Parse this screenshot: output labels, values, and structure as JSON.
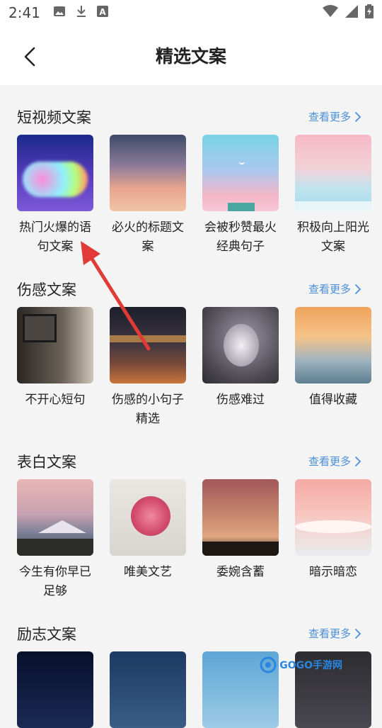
{
  "status": {
    "time": "2:41",
    "icons": [
      "image-icon",
      "download-icon",
      "text-a-icon"
    ],
    "right_icons": [
      "wifi-icon",
      "signal-icon",
      "battery-icon"
    ]
  },
  "header": {
    "title": "精选文案",
    "back_icon": "chevron-left-icon"
  },
  "more_label": "查看更多",
  "sections": [
    {
      "title": "短视频文案",
      "cards": [
        {
          "caption": "热门火爆的语句文案",
          "thumb": "rainbow-cloud"
        },
        {
          "caption": "必火的标题文案",
          "thumb": "pink-sky"
        },
        {
          "caption": "会被秒赞最火经典句子",
          "thumb": "moon-castle"
        },
        {
          "caption": "积极向上阳光文案",
          "thumb": "pastel-sea"
        }
      ]
    },
    {
      "title": "伤感文案",
      "cards": [
        {
          "caption": "不开心短句",
          "thumb": "dark-room"
        },
        {
          "caption": "伤感的小句子精选",
          "thumb": "night-city"
        },
        {
          "caption": "伤感难过",
          "thumb": "snow-tree"
        },
        {
          "caption": "值得收藏",
          "thumb": "sunset-birds"
        }
      ]
    },
    {
      "title": "表白文案",
      "cards": [
        {
          "caption": "今生有你早已足够",
          "thumb": "mountain-dusk"
        },
        {
          "caption": "唯美文艺",
          "thumb": "rose-heart"
        },
        {
          "caption": "委婉含蓄",
          "thumb": "silhouette-sky"
        },
        {
          "caption": "暗示暗恋",
          "thumb": "pink-waves"
        }
      ]
    },
    {
      "title": "励志文案",
      "cards": [
        {
          "caption": "",
          "thumb": "fireworks"
        },
        {
          "caption": "",
          "thumb": "blue-dusk"
        },
        {
          "caption": "",
          "thumb": "palm-beach"
        },
        {
          "caption": "",
          "thumb": "dark-window"
        }
      ]
    }
  ],
  "watermark": "GOGO手游网"
}
